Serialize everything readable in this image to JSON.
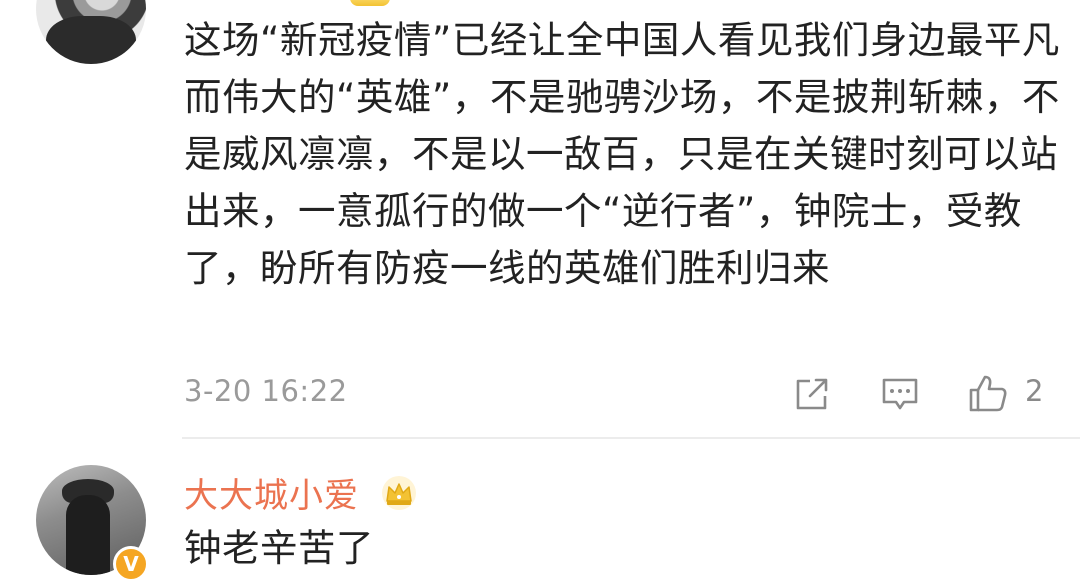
{
  "comment_1": {
    "text": "这场“新冠疫情”已经让全中国人看见我们身边最平凡而伟大的“英雄”，不是驰骋沙场，不是披荆斩棘，不是威风凛凛，不是以一敌百，只是在关键时刻可以站出来，一意孤行的做一个“逆行者”，钟院士，受教了，盼所有防疫一线的英雄们胜利归来",
    "time": "3-20 16:22",
    "like_count": "2",
    "icons": [
      "share-icon",
      "reply-icon",
      "like-icon"
    ]
  },
  "comment_2": {
    "username": "大大城小爱",
    "text": "钟老辛苦了",
    "badge_letter": "V",
    "icons": [
      "crown-icon",
      "verified-icon"
    ]
  },
  "colors": {
    "username": "#eb7350",
    "text": "#222222",
    "meta": "#9a9a9a",
    "verified": "#f5a623",
    "crown": "#f3c233"
  }
}
